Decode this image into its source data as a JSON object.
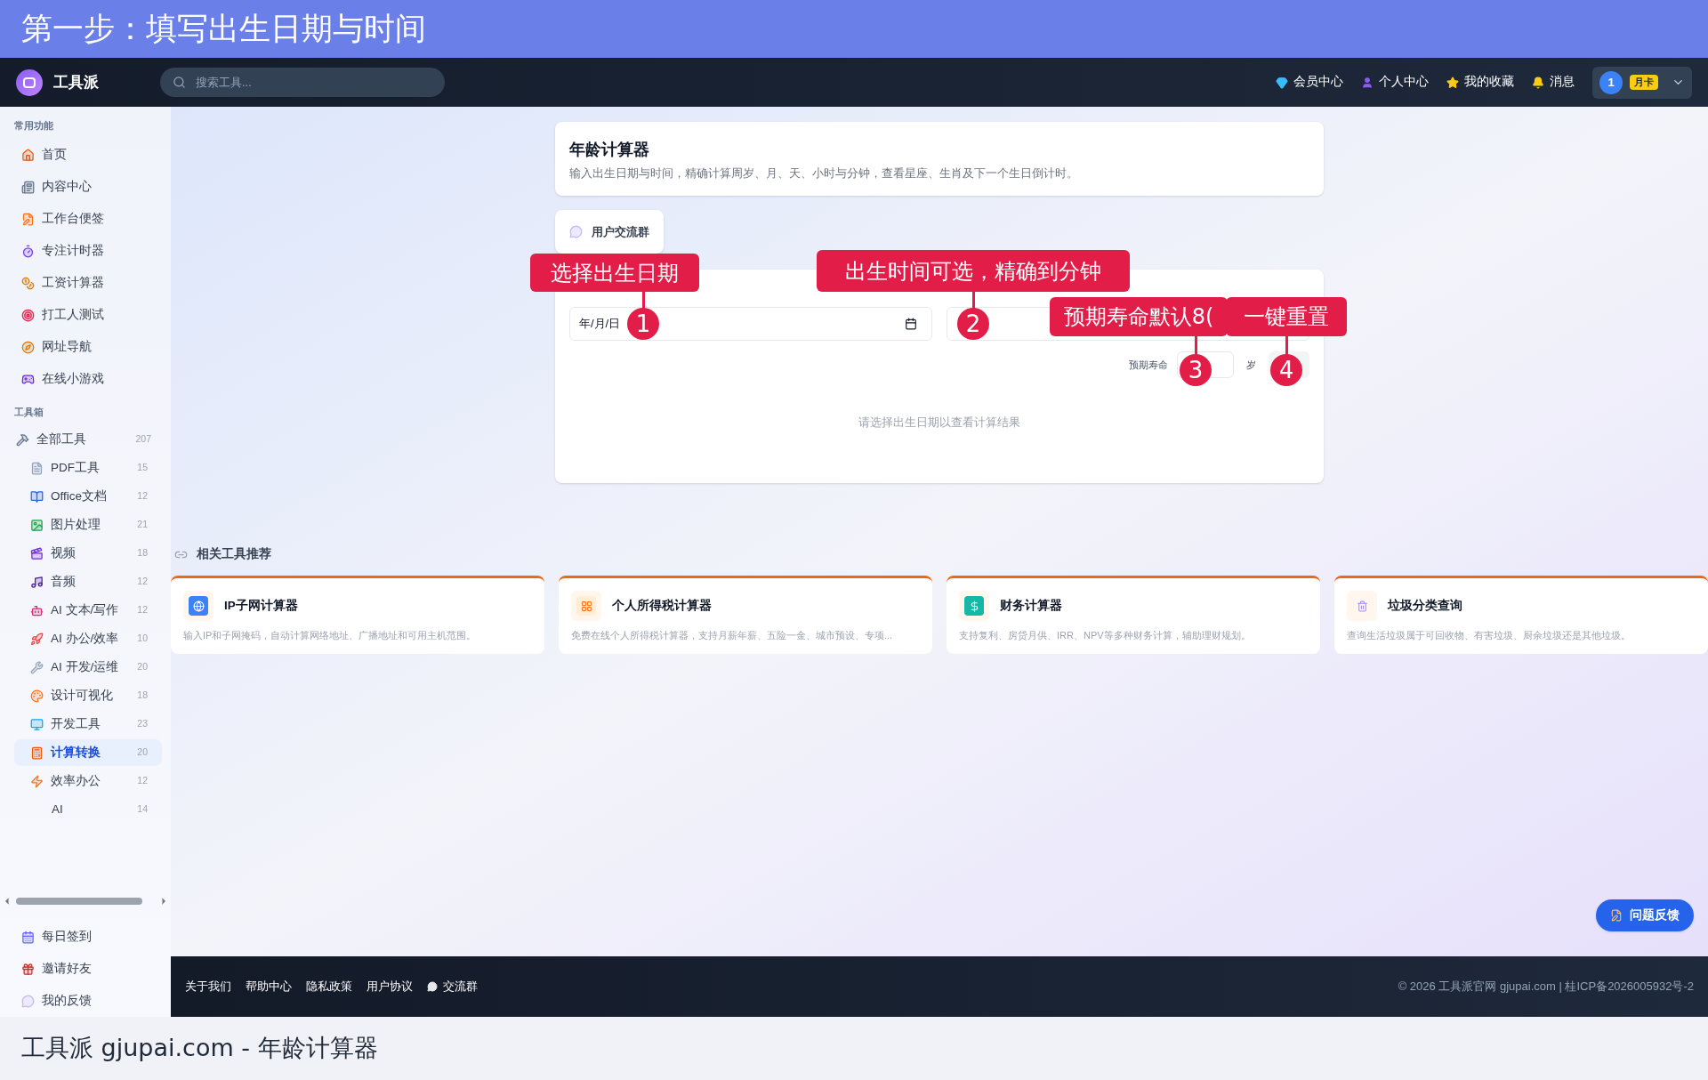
{
  "banner": {
    "title": "第一步：填写出生日期与时间"
  },
  "header": {
    "logo": "工具派",
    "search": {
      "placeholder": "搜索工具..."
    },
    "nav": [
      {
        "label": "会员中心",
        "kind": "diamond"
      },
      {
        "label": "个人中心",
        "kind": "user"
      },
      {
        "label": "我的收藏",
        "kind": "star"
      },
      {
        "label": "消息",
        "kind": "bell"
      }
    ],
    "user": {
      "avatar": "1",
      "badge": "月卡"
    }
  },
  "sidebar": {
    "sections": [
      {
        "title": "常用功能",
        "items": [
          {
            "label": "首页",
            "kind": "home"
          },
          {
            "label": "内容中心",
            "kind": "news"
          },
          {
            "label": "工作台便签",
            "kind": "note"
          },
          {
            "label": "专注计时器",
            "kind": "timer"
          },
          {
            "label": "工资计算器",
            "kind": "money"
          },
          {
            "label": "打工人测试",
            "kind": "target"
          },
          {
            "label": "网址导航",
            "kind": "compass"
          },
          {
            "label": "在线小游戏",
            "kind": "game"
          }
        ]
      }
    ],
    "toolbox": {
      "title": "工具箱",
      "items": [
        {
          "label": "全部工具",
          "count": "207",
          "kind": "tools",
          "selected": false,
          "children": [
            {
              "label": "PDF工具",
              "count": "15",
              "kind": "pdf",
              "selected": false
            },
            {
              "label": "Office文档",
              "count": "12",
              "kind": "book",
              "selected": false
            },
            {
              "label": "图片处理",
              "count": "21",
              "kind": "image",
              "selected": false
            },
            {
              "label": "视频",
              "count": "18",
              "kind": "video",
              "selected": false
            },
            {
              "label": "音频",
              "count": "12",
              "kind": "music",
              "selected": false
            },
            {
              "label": "AI 文本/写作",
              "count": "12",
              "kind": "bot",
              "selected": false
            },
            {
              "label": "AI 办公/效率",
              "count": "10",
              "kind": "rocket",
              "selected": false
            },
            {
              "label": "AI 开发/运维",
              "count": "20",
              "kind": "wrench",
              "selected": false
            },
            {
              "label": "设计可视化",
              "count": "18",
              "kind": "palette",
              "selected": false
            },
            {
              "label": "开发工具",
              "count": "23",
              "kind": "monitor",
              "selected": false
            },
            {
              "label": "计算转换",
              "count": "20",
              "kind": "abacus",
              "selected": true
            },
            {
              "label": "效率办公",
              "count": "12",
              "kind": "zap",
              "selected": false
            },
            {
              "label": "AI",
              "count": "14",
              "kind": "none",
              "selected": false
            }
          ]
        }
      ]
    },
    "bottom_items": [
      {
        "label": "每日签到",
        "kind": "calendar"
      },
      {
        "label": "邀请好友",
        "kind": "gift"
      },
      {
        "label": "我的反馈",
        "kind": "chat"
      }
    ]
  },
  "intro": {
    "title": "年龄计算器",
    "description": "输入出生日期与时间，精确计算周岁、月、天、小时与分钟，查看星座、生肖及下一个生日倒计时。"
  },
  "tab": {
    "label": "用户交流群"
  },
  "form": {
    "fields": [
      {
        "kind": "date",
        "value": "年/月/日"
      },
      {
        "kind": "time"
      }
    ],
    "expectancy": {
      "label": "预期寿命",
      "unit": "岁"
    },
    "empty_message": "请选择出生日期以查看计算结果"
  },
  "related": {
    "title": "相关工具推荐",
    "cards": [
      {
        "title": "IP子网计算器",
        "description": "输入IP和子网掩码，自动计算网络地址、广播地址和可用主机范围。",
        "kind": "globe"
      },
      {
        "title": "个人所得税计算器",
        "description": "免费在线个人所得税计算器，支持月薪年薪、五险一金、城市预设、专项...",
        "kind": "grid"
      },
      {
        "title": "财务计算器",
        "description": "支持复利、房贷月供、IRR、NPV等多种财务计算，辅助理财规划。",
        "kind": "money"
      },
      {
        "title": "垃圾分类查询",
        "description": "查询生活垃圾属于可回收物、有害垃圾、厨余垃圾还是其他垃圾。",
        "kind": "trash"
      }
    ]
  },
  "feedback_button": "问题反馈",
  "footer": {
    "links": [
      "关于我们",
      "帮助中心",
      "隐私政策",
      "用户协议"
    ],
    "group": "交流群",
    "copyright": "© 2026 工具派官网 gjupai.com | 桂ICP备2026005932号-2"
  },
  "annotations": [
    {
      "text": "选择出生日期",
      "number": "1"
    },
    {
      "text": "出生时间可选，精确到分钟",
      "number": "2"
    },
    {
      "text": "预期寿命默认8(",
      "number": "3"
    },
    {
      "text": "一键重置",
      "number": "4"
    }
  ],
  "caption": "工具派 gjupai.com - 年龄计算器"
}
